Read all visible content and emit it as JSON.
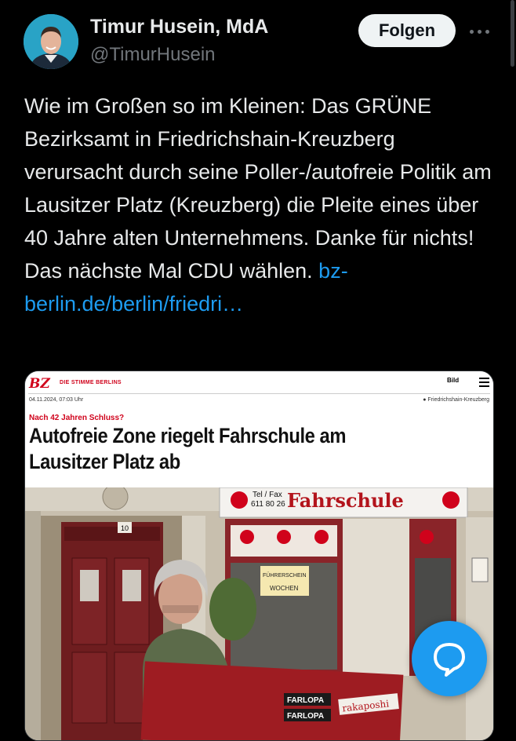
{
  "author": {
    "name": "Timur Husein, MdA",
    "handle": "@TimurHusein",
    "follow_label": "Folgen"
  },
  "tweet": {
    "text": "Wie im Großen so im Kleinen: Das GRÜNE Bezirksamt in Friedrichshain-Kreuzberg verursacht durch seine Poller-/autofreie Politik am Lausitzer Platz (Kreuzberg) die Pleite eines über 40 Jahre alten Unternehmens. Danke für nichts! Das nächste Mal CDU wählen.",
    "link_text": "bz-berlin.de/berlin/friedri…"
  },
  "article": {
    "logo": "BZ",
    "tagline": "DIE STIMME BERLINS",
    "partner": "Bild",
    "date": "04.11.2024, 07:03 Uhr",
    "location": "Friedrichshain-Kreuzberg",
    "kicker": "Nach 42 Jahren Schluss?",
    "headline": "Autofreie Zone riegelt Fahrschule am Lausitzer Platz ab"
  },
  "photo": {
    "sign_phone_label": "Tel / Fax",
    "sign_phone": "611 80 26",
    "sign_title": "Fahrschule",
    "door_number": "10",
    "window_sign_1": "FÜHRERSCHEIN",
    "window_sign_2": "WOCHEN",
    "sticker_1": "FARLOPA",
    "sticker_2": "FARLOPA",
    "sticker_3": "rakaposhi"
  },
  "icons": {
    "more": "more-horizontal-icon",
    "compose": "chat-bubble-icon"
  },
  "colors": {
    "background": "#000000",
    "text": "#e7e9ea",
    "secondary_text": "#71767b",
    "link": "#1d9bf0",
    "accent": "#1d9bf0",
    "bz_red": "#d0021b"
  }
}
